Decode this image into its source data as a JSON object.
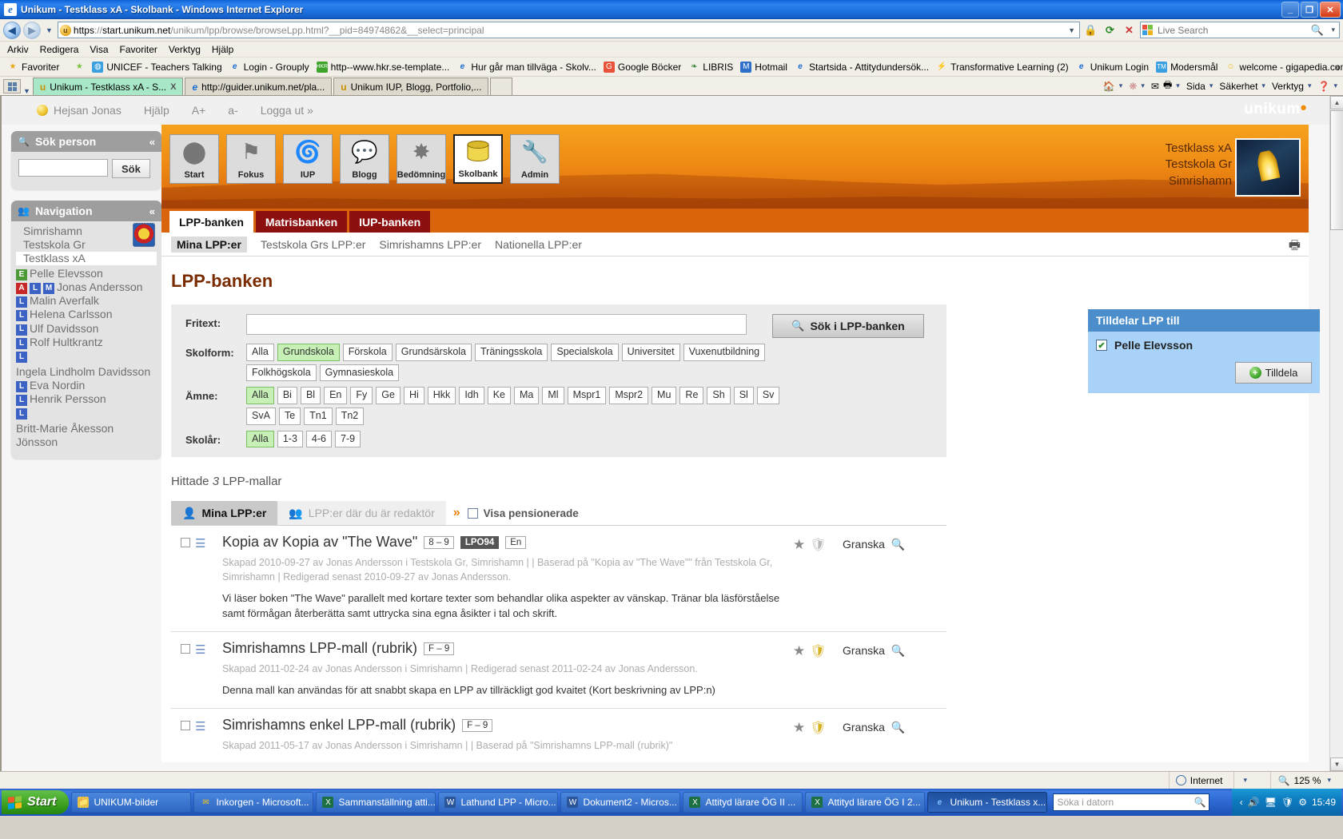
{
  "window": {
    "title": "Unikum - Testklass xA - Skolbank - Windows Internet Explorer",
    "minimize": "_",
    "maximize": "❐",
    "close": "✕"
  },
  "browser": {
    "url_scheme": "https",
    "url_sep": "://",
    "url_host": "start.unikum.net",
    "url_path": "/unikum/lpp/browse/browseLpp.html?__pid=84974862&__select=principal",
    "search_placeholder": "Live Search",
    "menu": [
      "Arkiv",
      "Redigera",
      "Visa",
      "Favoriter",
      "Verktyg",
      "Hjälp"
    ],
    "favorites_label": "Favoriter",
    "favorites": [
      {
        "label": "UNICEF - Teachers Talking",
        "icon": "globe-icon"
      },
      {
        "label": "Login - Grouply",
        "icon": "ie-icon"
      },
      {
        "label": "http--www.hkr.se-template...",
        "icon": "hkr-icon"
      },
      {
        "label": "Hur går man tillväga - Skolv...",
        "icon": "ie-icon"
      },
      {
        "label": "Google Böcker",
        "icon": "google-icon"
      },
      {
        "label": "LIBRIS",
        "icon": "libris-icon"
      },
      {
        "label": "Hotmail",
        "icon": "hotmail-icon"
      },
      {
        "label": "Startsida - Attitydundersök...",
        "icon": "ie-icon"
      },
      {
        "label": "Transformative Learning (2)",
        "icon": "lightning-icon"
      },
      {
        "label": "Unikum Login",
        "icon": "ie-icon"
      },
      {
        "label": "Modersmål",
        "icon": "tm-icon"
      },
      {
        "label": "welcome - gigapedia.com",
        "icon": "smiley-icon"
      }
    ],
    "tabs": [
      {
        "label": "Unikum - Testklass xA - S...",
        "active": true,
        "close": "X"
      },
      {
        "label": "http://guider.unikum.net/pla...",
        "active": false
      },
      {
        "label": "Unikum IUP, Blogg, Portfolio,...",
        "active": false
      }
    ],
    "commands": [
      "Sida",
      "Säkerhet",
      "Verktyg"
    ],
    "overflow": "»"
  },
  "topstrip": {
    "greeting": "Hejsan Jonas",
    "help": "Hjälp",
    "font_bigger": "A+",
    "font_smaller": "a-",
    "logout": "Logga ut »",
    "brand": "unikum"
  },
  "sidebar": {
    "search_panel": {
      "title": "Sök person",
      "collapse": "«",
      "input_value": "",
      "button": "Sök"
    },
    "nav_panel": {
      "title": "Navigation",
      "collapse": "«",
      "municipality": "Simrishamn",
      "school": "Testskola Gr",
      "klass": "Testklass xA",
      "people": [
        {
          "tags": [
            "E"
          ],
          "name": "Pelle Elevsson"
        },
        {
          "tags": [
            "A",
            "L",
            "M"
          ],
          "name": "Jonas Andersson"
        },
        {
          "tags": [
            "L"
          ],
          "name": "Malin Averfalk"
        },
        {
          "tags": [
            "L"
          ],
          "name": "Helena Carlsson"
        },
        {
          "tags": [
            "L"
          ],
          "name": "Ulf Davidsson"
        },
        {
          "tags": [
            "L"
          ],
          "name": "Rolf Hultkrantz"
        },
        {
          "tags": [
            "L"
          ],
          "name": "Ingela Lindholm Davidsson"
        },
        {
          "tags": [
            "L"
          ],
          "name": "Eva Nordin"
        },
        {
          "tags": [
            "L"
          ],
          "name": "Henrik Persson"
        },
        {
          "tags": [
            "L"
          ],
          "name": "Britt-Marie Åkesson Jönsson"
        }
      ]
    }
  },
  "appnav": {
    "items": [
      {
        "label": "Start",
        "icon": "sphere-icon",
        "selected": false
      },
      {
        "label": "Fokus",
        "icon": "flag-icon",
        "selected": false
      },
      {
        "label": "IUP",
        "icon": "spiral-icon",
        "selected": false
      },
      {
        "label": "Blogg",
        "icon": "speech-bubble-icon",
        "selected": false
      },
      {
        "label": "Bedömning",
        "icon": "compass-icon",
        "selected": false
      },
      {
        "label": "Skolbank",
        "icon": "database-icon",
        "selected": true
      },
      {
        "label": "Admin",
        "icon": "wrench-icon",
        "selected": false
      }
    ],
    "context": [
      "Testklass xA",
      "Testskola Gr",
      "Simrishamn"
    ]
  },
  "banktabs": [
    {
      "label": "LPP-banken",
      "active": true
    },
    {
      "label": "Matrisbanken",
      "active": false
    },
    {
      "label": "IUP-banken",
      "active": false
    }
  ],
  "subtabs": [
    {
      "label": "Mina LPP:er",
      "active": true
    },
    {
      "label": "Testskola Grs LPP:er",
      "active": false
    },
    {
      "label": "Simrishamns LPP:er",
      "active": false
    },
    {
      "label": "Nationella LPP:er",
      "active": false
    }
  ],
  "print_icon": "printer-icon",
  "page_title": "LPP-banken",
  "filters": {
    "fritext_label": "Fritext:",
    "fritext_value": "",
    "search_button": "Sök i LPP-banken",
    "search_icon": "magnifier-icon",
    "skolform_label": "Skolform:",
    "skolform": [
      {
        "label": "Alla",
        "on": false
      },
      {
        "label": "Grundskola",
        "on": true
      },
      {
        "label": "Förskola",
        "on": false
      },
      {
        "label": "Grundsärskola",
        "on": false
      },
      {
        "label": "Träningsskola",
        "on": false
      },
      {
        "label": "Specialskola",
        "on": false
      },
      {
        "label": "Universitet",
        "on": false
      },
      {
        "label": "Vuxenutbildning",
        "on": false
      },
      {
        "label": "Folkhögskola",
        "on": false
      },
      {
        "label": "Gymnasieskola",
        "on": false
      }
    ],
    "amne_label": "Ämne:",
    "amne": [
      {
        "label": "Alla",
        "on": true
      },
      {
        "label": "Bi",
        "on": false
      },
      {
        "label": "Bl",
        "on": false
      },
      {
        "label": "En",
        "on": false
      },
      {
        "label": "Fy",
        "on": false
      },
      {
        "label": "Ge",
        "on": false
      },
      {
        "label": "Hi",
        "on": false
      },
      {
        "label": "Hkk",
        "on": false
      },
      {
        "label": "Idh",
        "on": false
      },
      {
        "label": "Ke",
        "on": false
      },
      {
        "label": "Ma",
        "on": false
      },
      {
        "label": "Ml",
        "on": false
      },
      {
        "label": "Mspr1",
        "on": false
      },
      {
        "label": "Mspr2",
        "on": false
      },
      {
        "label": "Mu",
        "on": false
      },
      {
        "label": "Re",
        "on": false
      },
      {
        "label": "Sh",
        "on": false
      },
      {
        "label": "Sl",
        "on": false
      },
      {
        "label": "Sv",
        "on": false
      },
      {
        "label": "SvA",
        "on": false
      },
      {
        "label": "Te",
        "on": false
      },
      {
        "label": "Tn1",
        "on": false
      },
      {
        "label": "Tn2",
        "on": false
      }
    ],
    "skolar_label": "Skolår:",
    "skolar": [
      {
        "label": "Alla",
        "on": true
      },
      {
        "label": "1-3",
        "on": false
      },
      {
        "label": "4-6",
        "on": false
      },
      {
        "label": "7-9",
        "on": false
      }
    ]
  },
  "results": {
    "found_prefix": "Hittade",
    "found_count": "3",
    "found_suffix": "LPP-mallar",
    "list_tabs": [
      {
        "label": "Mina LPP:er",
        "active": true,
        "icon": "person-icon"
      },
      {
        "label": "LPP:er där du är redaktör",
        "active": false,
        "icon": "people-icon"
      }
    ],
    "more_arrow": "»",
    "pensionerade_label": "Visa pensionerade",
    "pensionerade_checked": false,
    "granska_label": "Granska",
    "rows": [
      {
        "title": "Kopia av Kopia av \"The Wave\"",
        "badges": [
          {
            "label": "8 – 9",
            "dark": false
          },
          {
            "label": "LPO94",
            "dark": true
          },
          {
            "label": "En",
            "dark": false
          }
        ],
        "meta": "Skapad 2010-09-27 av Jonas Andersson i Testskola Gr, Simrishamn | | Baserad på \"Kopia av \"The Wave\"\" från Testskola Gr, Simrishamn | Redigerad senast 2010-09-27 av Jonas Andersson.",
        "desc": "Vi läser boken \"The Wave\" parallelt med kortare texter som behandlar olika aspekter av vänskap. Tränar bla läsförståelse samt förmågan återberätta samt uttrycka sina egna åsikter i tal och skrift.",
        "star": true,
        "shield": "grey"
      },
      {
        "title": "Simrishamns LPP-mall (rubrik)",
        "badges": [
          {
            "label": "F – 9",
            "dark": false
          }
        ],
        "meta": "Skapad 2011-02-24 av Jonas Andersson i Simrishamn | Redigerad senast 2011-02-24 av Jonas Andersson.",
        "desc": "Denna mall kan användas för att snabbt skapa en LPP av tillräckligt god kvaitet (Kort beskrivning av LPP:n)",
        "star": true,
        "shield": "gold"
      },
      {
        "title": "Simrishamns enkel LPP-mall (rubrik)",
        "badges": [
          {
            "label": "F – 9",
            "dark": false
          }
        ],
        "meta": "Skapad 2011-05-17 av Jonas Andersson i Simrishamn | | Baserad på \"Simrishamns LPP-mall (rubrik)\"",
        "desc": "",
        "star": true,
        "shield": "gold"
      }
    ]
  },
  "assign_panel": {
    "title": "Tilldelar LPP till",
    "person": "Pelle Elevsson",
    "checked": true,
    "button": "Tilldela",
    "button_icon": "plus-circle-icon"
  },
  "statusbar": {
    "zone": "Internet",
    "zone_icon": "globe-icon",
    "zoom": "125 %"
  },
  "taskbar": {
    "start": "Start",
    "buttons": [
      {
        "label": "UNIKUM-bilder",
        "active": false,
        "icon": "folder-icon"
      },
      {
        "label": "Inkorgen - Microsoft...",
        "active": false,
        "icon": "mail-icon"
      },
      {
        "label": "Sammanställning atti...",
        "active": false,
        "icon": "excel-icon"
      },
      {
        "label": "Lathund LPP - Micro...",
        "active": false,
        "icon": "word-icon"
      },
      {
        "label": "Dokument2 - Micros...",
        "active": false,
        "icon": "word-icon"
      },
      {
        "label": "Attityd lärare ÖG II ...",
        "active": false,
        "icon": "excel-icon"
      },
      {
        "label": "Attityd lärare ÖG I 2...",
        "active": false,
        "icon": "excel-icon"
      },
      {
        "label": "Unikum - Testklass x...",
        "active": true,
        "icon": "ie-icon"
      }
    ],
    "search_placeholder": "Söka i datorn",
    "clock": "15:49"
  },
  "colors": {
    "accent_orange": "#e8820c",
    "brand_red": "#8c1010",
    "assign_blue": "#4b8ecb",
    "chip_on": "#c6f0b6"
  }
}
